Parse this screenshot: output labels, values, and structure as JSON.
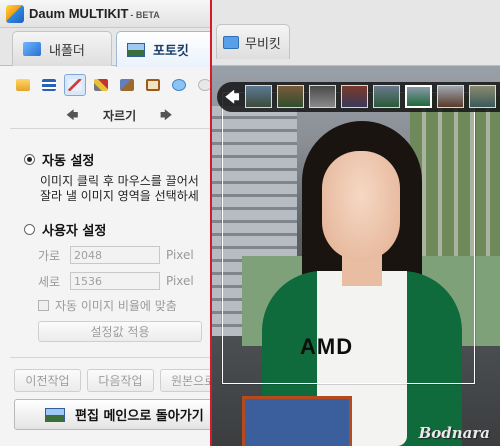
{
  "app": {
    "title": "Daum MULTIKIT",
    "badge": "- BETA"
  },
  "tabs": [
    {
      "label": "내폴더",
      "icon": "folder-icon",
      "selected": false
    },
    {
      "label": "포토킷",
      "icon": "photo-icon",
      "selected": true
    },
    {
      "label": "무비킷",
      "icon": "movie-icon",
      "selected": false
    }
  ],
  "toolbar": {
    "tools": [
      {
        "icon": "open-folder-icon",
        "active": false
      },
      {
        "icon": "adjust-icon",
        "active": false
      },
      {
        "icon": "crop-scissors-icon",
        "active": true
      },
      {
        "icon": "tools-icon",
        "active": false
      },
      {
        "icon": "frame-icon",
        "active": false
      },
      {
        "icon": "speech-bubble-icon",
        "active": false
      },
      {
        "icon": "more-icon",
        "active": false
      }
    ],
    "current_tool_label": "자르기",
    "prev_glyph": "🡄",
    "next_glyph": "🡆"
  },
  "crop": {
    "auto": {
      "label": "자동 설정",
      "selected": true,
      "desc_line1": "이미지 클릭 후 마우스를 끌어서",
      "desc_line2": "잘라 낼 이미지 영역을 선택하세"
    },
    "custom": {
      "label": "사용자 설정",
      "selected": false
    },
    "width_label": "가로",
    "width_value": "2048",
    "height_label": "세로",
    "height_value": "1536",
    "unit": "Pixel",
    "ratio_label": "자동 이미지 비율에 맞춤",
    "ratio_checked": false,
    "apply_label": "설정값 적용"
  },
  "history": {
    "undo_label": "이전작업",
    "redo_label": "다음작업",
    "original_label": "원본으로"
  },
  "back_label": "편집 메인으로 돌아가기",
  "preview": {
    "shirt_text": "AMD",
    "watermark": "Bodnara",
    "back_glyph": "🡄",
    "thumbnails": 8,
    "active_thumbnail": 5
  },
  "colors": {
    "divider": "#d61a2a",
    "accent": "#1a3c66",
    "shirt": "#0f6a3c"
  }
}
